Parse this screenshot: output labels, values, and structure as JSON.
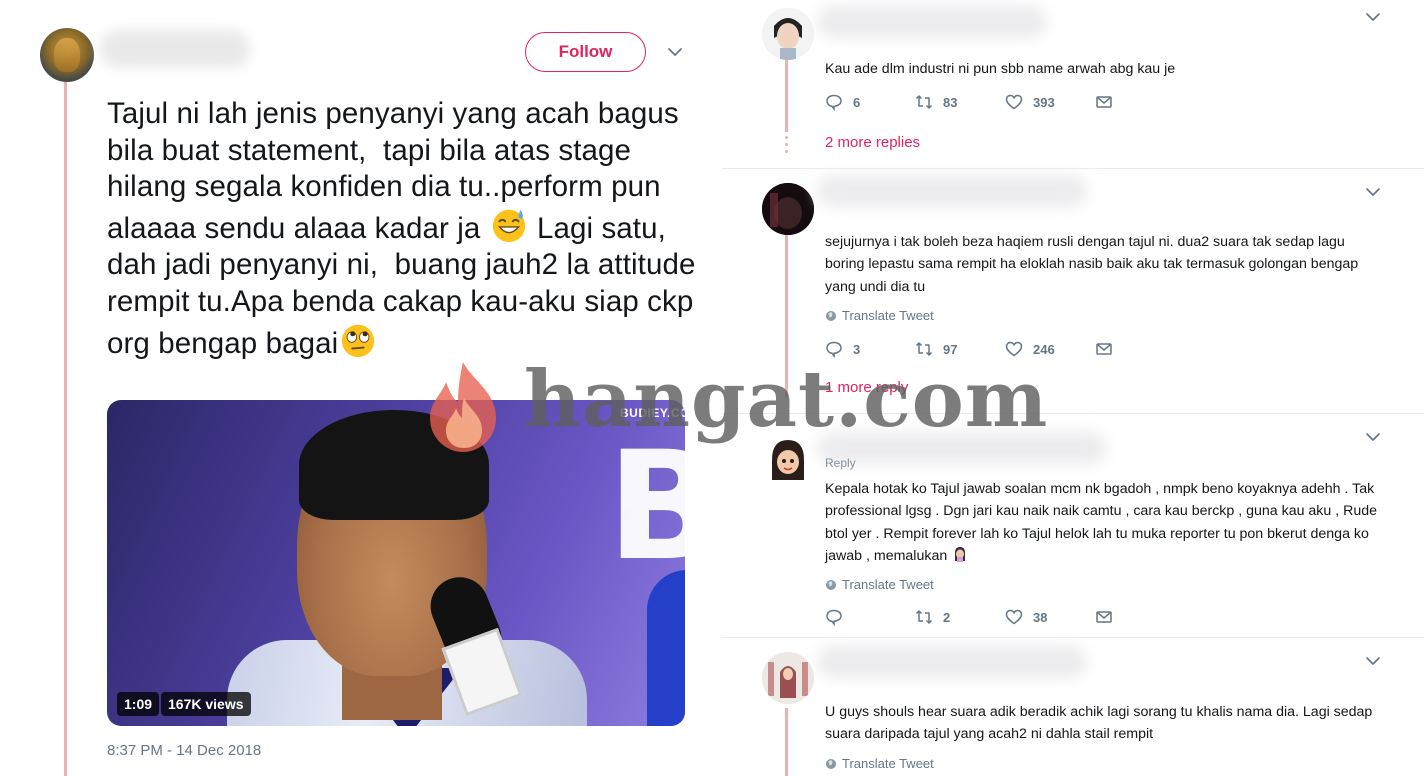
{
  "tweet": {
    "follow_label": "Follow",
    "text_part1": "Tajul ni lah jenis penyanyi yang acah bagus bila buat statement,  tapi bila atas stage hilang segala konfiden dia tu..perform pun alaaaa sendu alaaa kadar ja ",
    "text_part2": " Lagi satu, dah jadi penyanyi ni,  buang jauh2 la attitude rempit tu.Apa benda cakap kau-aku siap ckp org bengap bagai",
    "emoji_1": "sweat-smile-emoji",
    "emoji_2": "rolling-eyes-emoji",
    "video": {
      "duration": "1:09",
      "views": "167K views",
      "channel_watermark": "BUDIEY.COM",
      "mic_flag": "BUDIEY.COM"
    },
    "timestamp": "8:37 PM - 14 Dec 2018"
  },
  "replies": [
    {
      "text": "Kau ade dlm industri ni pun sbb name arwah abg kau je",
      "comments": "6",
      "retweets": "83",
      "likes": "393",
      "more_replies": "2 more replies"
    },
    {
      "text": "sejujurnya i tak boleh beza haqiem rusli dengan tajul ni. dua2 suara tak sedap lagu boring lepastu sama rempit ha eloklah nasib baik aku tak termasuk golongan bengap yang undi dia tu",
      "translate": "Translate Tweet",
      "comments": "3",
      "retweets": "97",
      "likes": "246",
      "more_replies": "1 more reply"
    },
    {
      "handle_partial": "Reply",
      "text": "Kepala hotak ko Tajul jawab soalan mcm nk bgadoh , nmpk beno koyaknya adehh . Tak professional lgsg . Dgn jari kau naik naik camtu , cara kau berckp , guna kau aku , Rude btol yer . Rempit forever lah ko Tajul helok lah tu muka reporter tu pon bkerut denga ko jawab , memalukan ",
      "emoji": "facepalm-emoji",
      "translate": "Translate Tweet",
      "comments": "",
      "retweets": "2",
      "likes": "38"
    },
    {
      "text": "U guys shouls hear suara adik beradik achik lagi sorang tu khalis nama dia. Lagi sedap suara daripada tajul yang acah2 ni dahla stail rempit",
      "translate": "Translate Tweet"
    }
  ],
  "watermark": {
    "text": "hangat.com"
  },
  "colors": {
    "accent": "#e0245e",
    "thread_line": "#e7b3b3",
    "muted": "#657786",
    "text": "#14171a"
  }
}
